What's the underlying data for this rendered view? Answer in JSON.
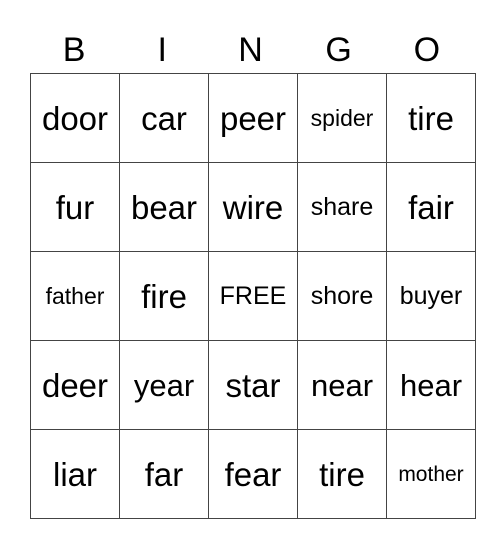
{
  "header": [
    "B",
    "I",
    "N",
    "G",
    "O"
  ],
  "grid": [
    [
      "door",
      "car",
      "peer",
      "spider",
      "tire"
    ],
    [
      "fur",
      "bear",
      "wire",
      "share",
      "fair"
    ],
    [
      "father",
      "fire",
      "FREE",
      "shore",
      "buyer"
    ],
    [
      "deer",
      "year",
      "star",
      "near",
      "hear"
    ],
    [
      "liar",
      "far",
      "fear",
      "tire",
      "mother"
    ]
  ]
}
